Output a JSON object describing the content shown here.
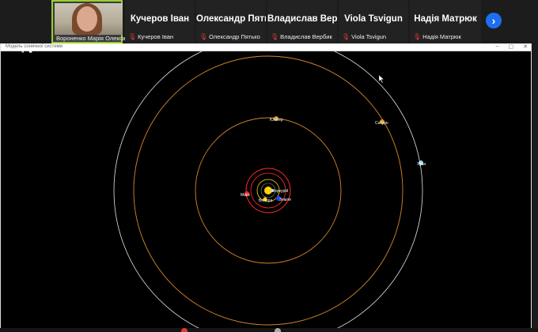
{
  "participants": [
    {
      "id": "p1",
      "name_small": "Вороненко Марія Олекса...",
      "active": true
    },
    {
      "id": "p2",
      "name_big": "Кучеров Іван",
      "name_small": "Кучеров Іван"
    },
    {
      "id": "p3",
      "name_big": "Олександр Пятько",
      "name_small": "Олександр Пятько"
    },
    {
      "id": "p4",
      "name_big": "Владислав Вербик",
      "name_small": "Владислав Вербик"
    },
    {
      "id": "p5",
      "name_big": "Viola Tsvigun",
      "name_small": "Viola Tsvigun"
    },
    {
      "id": "p6",
      "name_big": "Надія Матрюк",
      "name_small": "Надія Матрюк"
    }
  ],
  "next_icon": "chevron-right-icon",
  "window": {
    "title": "Модель сонячної системи"
  },
  "controls": {
    "pause": "⏸",
    "stop": "■"
  },
  "planets": {
    "mercury": "Меркурій",
    "venus": "Венера",
    "earth": "Земля",
    "mars": "Марс",
    "jupiter": "Юпітер",
    "saturn": "Сатурн",
    "uranus": "Уран"
  },
  "colors": {
    "accent": "#1e6ef0",
    "orbit_inner": "#ff2a2a",
    "orbit_outer": "#d7862c",
    "orbit_far": "#e6e6e6"
  }
}
